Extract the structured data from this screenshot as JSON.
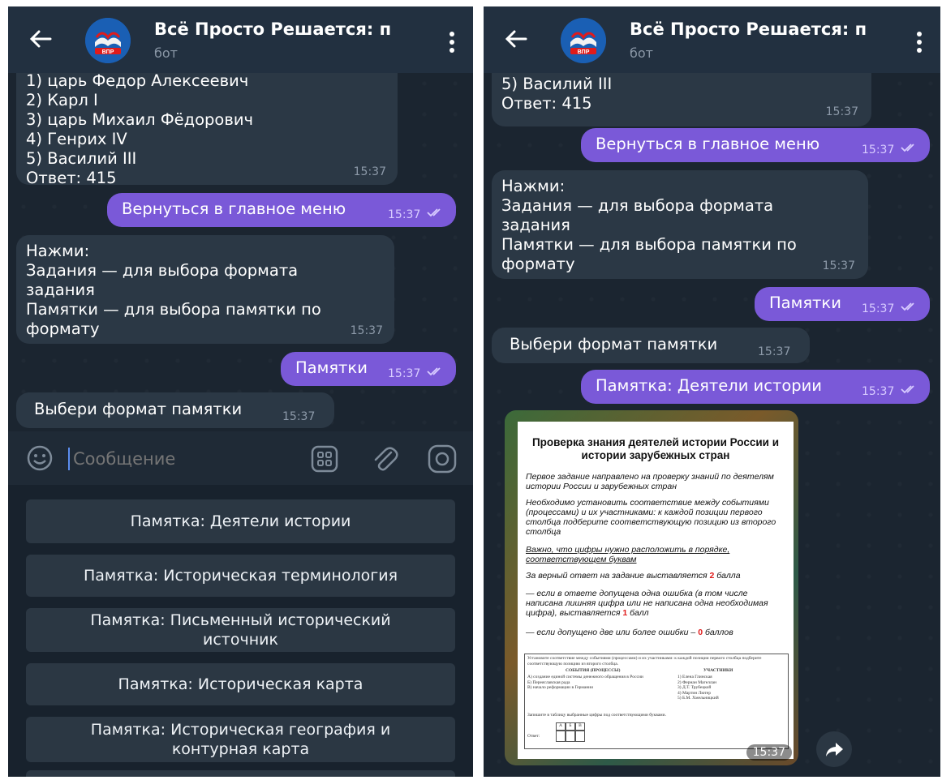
{
  "chat": {
    "title": "Всё Просто Решается: п",
    "subtitle": "бот",
    "avatar_text": "ВПР"
  },
  "left": {
    "answer_lines": [
      "1) царь Федор Алексеевич",
      "2) Карл I",
      "3) царь Михаил Фёдорович",
      "4) Генрих IV",
      "5) Василий III",
      "Ответ: 415"
    ],
    "answer_time": "15:37",
    "msg_menu": "Вернуться в главное меню",
    "msg_menu_time": "15:37",
    "msg_instr_lines": [
      "Нажми:",
      "Задания — для выбора формата",
      "задания",
      "Памятки — для выбора памятки по",
      "формату"
    ],
    "msg_instr_time": "15:37",
    "msg_pamyatki": "Памятки",
    "msg_pamyatki_time": "15:37",
    "msg_choose": "Выбери формат памятки",
    "msg_choose_time": "15:37",
    "composer_placeholder": "Сообщение",
    "keyboard": [
      "Памятка: Деятели истории",
      "Памятка: Историческая терминология",
      "Памятка: Письменный исторический источник",
      "Памятка: Историческая карта",
      "Памятка: Историческая география и контурная карта"
    ]
  },
  "right": {
    "answer_lines": [
      "5) Василий III",
      "Ответ: 415"
    ],
    "answer_time": "15:37",
    "msg_menu": "Вернуться в главное меню",
    "msg_menu_time": "15:37",
    "msg_instr_lines": [
      "Нажми:",
      "Задания — для выбора формата",
      "задания",
      "Памятки — для выбора памятки по",
      "формату"
    ],
    "msg_instr_time": "15:37",
    "msg_pamyatki": "Памятки",
    "msg_pamyatki_time": "15:37",
    "msg_choose": "Выбери формат памятки",
    "msg_choose_time": "15:37",
    "msg_deyateli": "Памятка: Деятели истории",
    "msg_deyateli_time": "15:37",
    "doc_time": "15:37",
    "doc": {
      "title": "Проверка знания деятелей истории России и истории зарубежных стран",
      "p1": "Первое задание направлено на проверку знаний по деятелям истории России и зарубежных стран",
      "p2": "Необходимо установить соответствие между событиями (процессами) и их участниками: к каждой позиции первого столбца подберите соответствующую позицию из второго столбца",
      "p3": "Важно, что цифры нужно расположить в порядке, соответствующем буквам",
      "p4_a": "За верный ответ на задание выставляется ",
      "p4_num": "2",
      "p4_b": " балла",
      "p5_a": "— если в ответе допущена одна ошибка (в том числе написана лишняя цифра или не написана одна необходимая цифра), выставляется ",
      "p5_num": "1",
      "p5_b": " балл",
      "p6_a": "— если допущено две или более ошибки – ",
      "p6_num": "0",
      "p6_b": " баллов",
      "table_head": "Установите соответствие между событиями (процессами) и их участниками: к каждой позиции первого столбца подберите соответствующую позицию из второго столбца.",
      "table_col1": "СОБЫТИЯ (ПРОЦЕССЫ)",
      "table_col2": "УЧАСТНИКИ",
      "events": [
        "А) создание единой системы денежного обращения в России",
        "Б) Переяславская рада",
        "В) начало реформации в Германии"
      ],
      "people": [
        "1) Елена Глинская",
        "2) Фернан Магеллан",
        "3) Д.Т. Трубецкой",
        "4) Мартин Лютер",
        "5) Б.М. Хмельницкий"
      ],
      "table_note": "Запишите в таблицу выбранные цифры под соответствующими буквами.",
      "answer_label": "Ответ:",
      "answer_cols": [
        "А",
        "Б",
        "В"
      ]
    }
  },
  "colors": {
    "outgoing": "#7a59d8",
    "incoming": "#2b3845",
    "header": "#223040",
    "bg": "#1b2530"
  }
}
